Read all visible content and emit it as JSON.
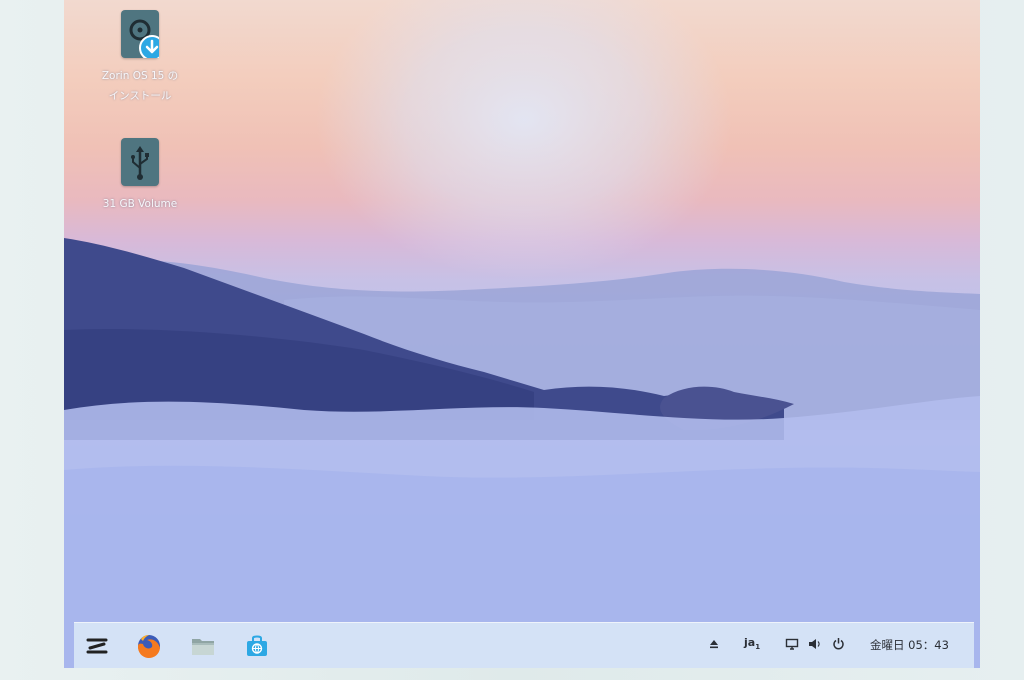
{
  "desktop": {
    "icons": [
      {
        "name": "install-zorin",
        "label_line1": "Zorin OS 15 の",
        "label_line2": "インストール",
        "icon": "install-disc-icon"
      },
      {
        "name": "usb-volume",
        "label_line1": "31 GB Volume",
        "icon": "usb-drive-icon"
      }
    ]
  },
  "taskbar": {
    "apps": [
      {
        "name": "zorin-menu",
        "icon": "zorin-logo-icon"
      },
      {
        "name": "firefox",
        "icon": "firefox-icon"
      },
      {
        "name": "files",
        "icon": "folder-icon"
      },
      {
        "name": "software-store",
        "icon": "store-bag-icon"
      }
    ],
    "tray": {
      "input_method": "ja",
      "input_method_sub": "1",
      "clock": "金曜日 05：43"
    }
  },
  "colors": {
    "accent_blue": "#2da8e4",
    "icon_tile": "#4f7580",
    "taskbar_bg": "#d7e5f6"
  }
}
